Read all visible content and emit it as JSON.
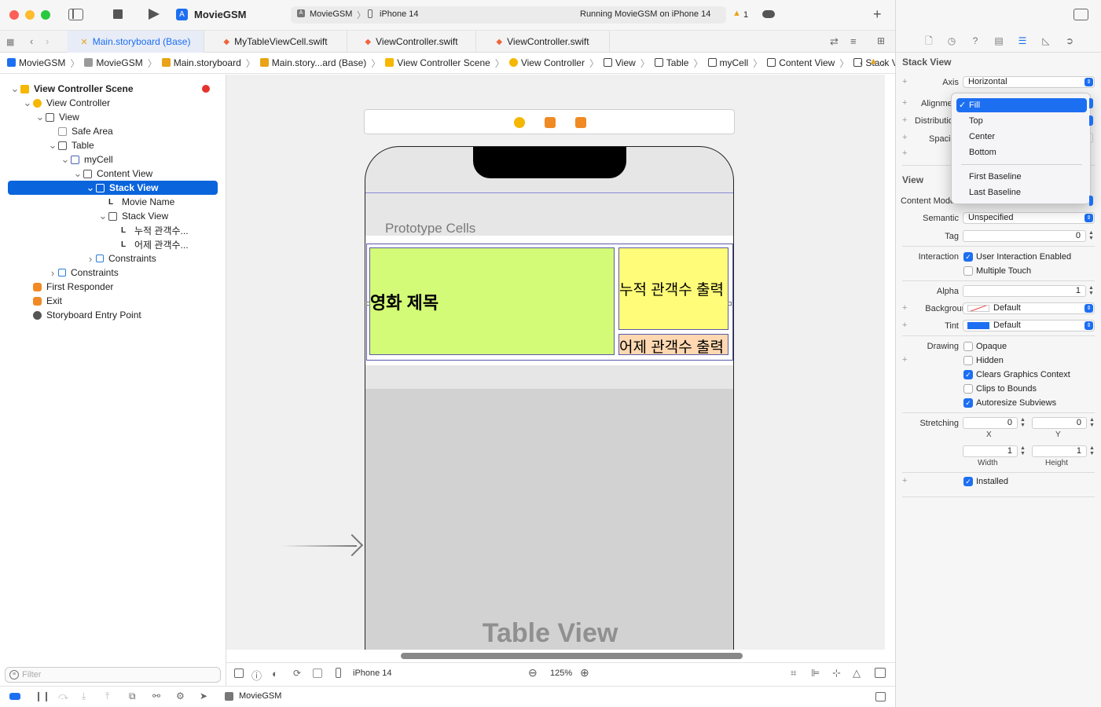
{
  "window": {
    "app_name": "MovieGSM",
    "scheme": "MovieGSM",
    "device": "iPhone 14",
    "status": "Running MovieGSM on iPhone 14",
    "warning_count": "1"
  },
  "tabs": [
    {
      "label": "Main.storyboard (Base)",
      "icon": "storyboard-icon",
      "active": true
    },
    {
      "label": "MyTableViewCell.swift",
      "icon": "swift-icon"
    },
    {
      "label": "ViewController.swift",
      "icon": "swift-icon"
    },
    {
      "label": "ViewController.swift",
      "icon": "swift-icon"
    }
  ],
  "breadcrumb": [
    "MovieGSM",
    "MovieGSM",
    "Main.storyboard",
    "Main.story...ard (Base)",
    "View Controller Scene",
    "View Controller",
    "View",
    "Table",
    "myCell",
    "Content View",
    "Stack View"
  ],
  "outline": [
    {
      "label": "View Controller Scene",
      "depth": 0,
      "chevron": "down",
      "icon": "scene-icon",
      "bold": true
    },
    {
      "label": "View Controller",
      "depth": 1,
      "chevron": "down",
      "icon": "view-controller-icon"
    },
    {
      "label": "View",
      "depth": 2,
      "chevron": "down",
      "icon": "view-icon"
    },
    {
      "label": "Safe Area",
      "depth": 3,
      "chevron": "",
      "icon": "safe-area-icon"
    },
    {
      "label": "Table",
      "depth": 3,
      "chevron": "down",
      "icon": "table-icon"
    },
    {
      "label": "myCell",
      "depth": 4,
      "chevron": "down",
      "icon": "cell-icon"
    },
    {
      "label": "Content View",
      "depth": 5,
      "chevron": "down",
      "icon": "view-icon"
    },
    {
      "label": "Stack View",
      "depth": 6,
      "chevron": "down",
      "icon": "stack-view-icon",
      "selected": true
    },
    {
      "label": "Movie Name",
      "depth": 7,
      "chevron": "",
      "icon": "label-icon"
    },
    {
      "label": "Stack View",
      "depth": 7,
      "chevron": "down",
      "icon": "stack-view-icon"
    },
    {
      "label": "누적 관객수...",
      "depth": 8,
      "chevron": "",
      "icon": "label-icon"
    },
    {
      "label": "어제 관객수...",
      "depth": 8,
      "chevron": "",
      "icon": "label-icon"
    },
    {
      "label": "Constraints",
      "depth": 6,
      "chevron": "right",
      "icon": "constraints-icon"
    },
    {
      "label": "Constraints",
      "depth": 3,
      "chevron": "right",
      "icon": "constraints-icon"
    },
    {
      "label": "First Responder",
      "depth": 1,
      "chevron": "",
      "icon": "first-responder-icon"
    },
    {
      "label": "Exit",
      "depth": 1,
      "chevron": "",
      "icon": "exit-icon"
    },
    {
      "label": "Storyboard Entry Point",
      "depth": 1,
      "chevron": "",
      "icon": "entry-point-icon"
    }
  ],
  "filter": {
    "placeholder": "Filter"
  },
  "canvas": {
    "prototype_cells": "Prototype Cells",
    "movie_title": "영화 제목",
    "total_audience": "누적 관객수 출력",
    "yesterday_audience": "어제 관객수 출력",
    "table_view": "Table View",
    "colors": {
      "green": "#d4fb78",
      "yellow": "#fffc79",
      "peach": "#ffd8b1"
    }
  },
  "bottom_bar": {
    "device": "iPhone 14",
    "zoom": "125%"
  },
  "status_bar": {
    "target": "MovieGSM"
  },
  "inspector": {
    "section_title": "Stack View",
    "axis_label": "Axis",
    "axis_value": "Horizontal",
    "alignment_label": "Alignment",
    "distribution_label": "Distribution",
    "spacing_label": "Spacing",
    "view_title": "View",
    "content_mode_label": "Content Mode",
    "semantic_label": "Semantic",
    "semantic_value": "Unspecified",
    "tag_label": "Tag",
    "tag_value": "0",
    "interaction_label": "Interaction",
    "user_interaction": "User Interaction Enabled",
    "multiple_touch": "Multiple Touch",
    "alpha_label": "Alpha",
    "alpha_value": "1",
    "background_label": "Background",
    "background_value": "Default",
    "tint_label": "Tint",
    "tint_value": "Default",
    "drawing_label": "Drawing",
    "opaque": "Opaque",
    "hidden": "Hidden",
    "clears_graphics": "Clears Graphics Context",
    "clips_bounds": "Clips to Bounds",
    "autoresize": "Autoresize Subviews",
    "stretching_label": "Stretching",
    "stretch_x": "0",
    "stretch_y": "0",
    "stretch_w": "1",
    "stretch_h": "1",
    "x_label": "X",
    "y_label": "Y",
    "width_label": "Width",
    "height_label": "Height",
    "installed": "Installed"
  },
  "alignment_menu": {
    "check": "✓",
    "items": [
      "Fill",
      "Top",
      "Center",
      "Bottom",
      "First Baseline",
      "Last Baseline"
    ]
  }
}
